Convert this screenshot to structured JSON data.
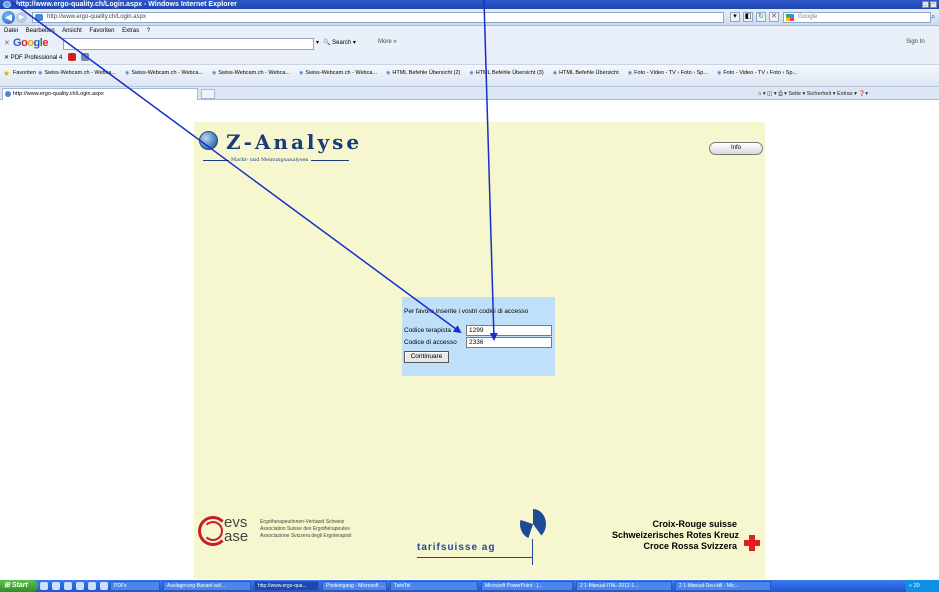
{
  "window": {
    "title": "http://www.ergo-quality.ch/Login.aspx - Windows Internet Explorer",
    "url": "http://www.ergo-quality.ch/Login.aspx",
    "search_placeholder": "Google"
  },
  "menu": [
    "Datei",
    "Bearbeiten",
    "Ansicht",
    "Favoriten",
    "Extras",
    "?"
  ],
  "google_toolbar": {
    "search_label": "Search",
    "more_label": "More »",
    "signin_label": "Sign In"
  },
  "pdf_toolbar": {
    "label": "PDF Professional 4"
  },
  "favorites": {
    "label": "Favoriten",
    "items": [
      "Swiss-Webcam.ch - Webca...",
      "Swiss-Webcam.ch - Webca...",
      "Swiss-Webcam.ch - Webca...",
      "Swiss-Webcam.ch - Webca...",
      "HTML Befehle Übersicht (2)",
      "HTML Befehle Übersicht (3)",
      "HTML Befehle Übersicht",
      "Foto - Video - TV › Foto › Sp...",
      "Foto - Video - TV › Foto › Sp..."
    ]
  },
  "tab": {
    "title": "http://www.ergo-quality.ch/Login.aspx"
  },
  "command_bar": "Seite ▾  Sicherheit ▾  Extras ▾",
  "page": {
    "brand_name": "Z-Analyse",
    "brand_sub": "Markt- und Meinungsanalysen",
    "info_button": "Info",
    "login": {
      "prompt": "Per favore inserite i vostri codici di accesso",
      "therapist_label": "Codice terapista",
      "therapist_value": "1299",
      "access_label": "Codice di accesso",
      "access_value": "2336",
      "submit_label": "Continuare"
    },
    "evs": {
      "line1": "evs",
      "line2": "ase",
      "text": [
        "Ergotherapeutinnen-Verband Schweiz",
        "Association Suisse des Ergothérapeutes",
        "Associazione Svizzera degli Ergoterapisti"
      ]
    },
    "tarifsuisse": "tarifsuisse ag",
    "redcross": [
      "Croix-Rouge suisse",
      "Schweizerisches Rotes Kreuz",
      "Croce Rossa Svizzera"
    ]
  },
  "taskbar": {
    "start_label": "Start",
    "tasks": [
      "PDFs",
      "Auslagerung-Bananl-auf...",
      "http://www.ergo-qua...",
      "Posteingang - Microsoft ...",
      "TwixTel",
      "Microsoft PowerPoint - [...",
      "2 1-Manual-ITAL-2012-1...",
      "2 1-Manual-Deu-kill - Mic..."
    ],
    "tray": "« 20"
  }
}
